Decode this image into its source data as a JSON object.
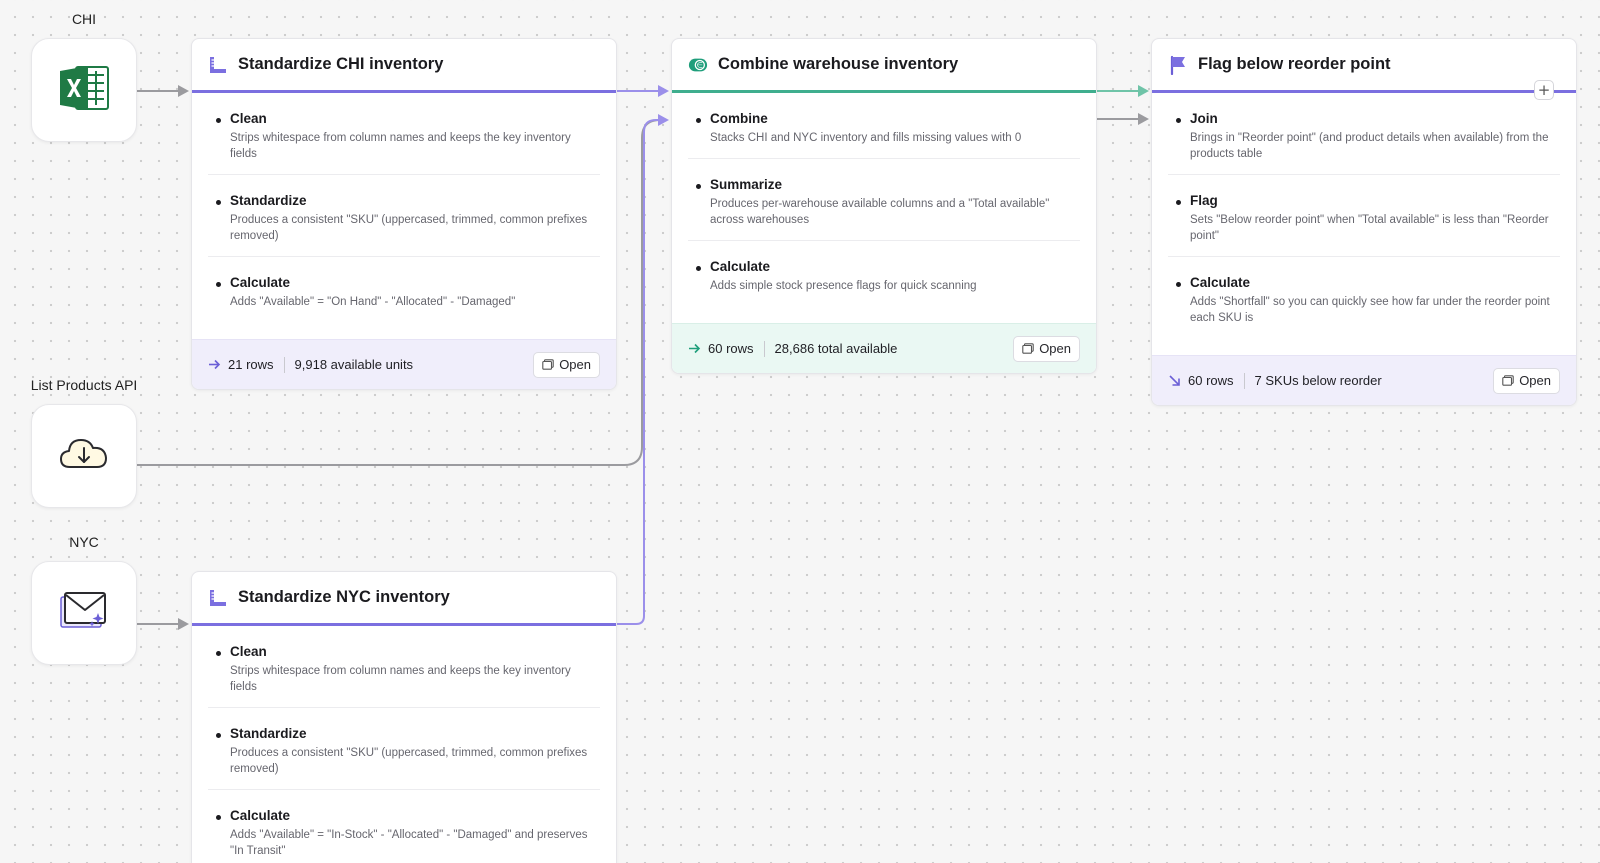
{
  "sources": {
    "chi": {
      "label": "CHI",
      "icon": "excel-icon"
    },
    "api": {
      "label": "List Products API",
      "icon": "cloud-download-icon"
    },
    "nyc": {
      "label": "NYC",
      "icon": "email-sparkle-icon"
    }
  },
  "cards": {
    "std_chi": {
      "title": "Standardize CHI inventory",
      "icon": "ruler-icon",
      "steps": [
        {
          "title": "Clean",
          "desc": "Strips whitespace from column names and keeps the key inventory fields"
        },
        {
          "title": "Standardize",
          "desc": "Produces a consistent \"SKU\" (uppercased, trimmed, common prefixes removed)"
        },
        {
          "title": "Calculate",
          "desc": "Adds \"Available\" = \"On Hand\" - \"Allocated\" - \"Damaged\""
        }
      ],
      "footer": {
        "rows": "21 rows",
        "metric": "9,918 available units",
        "open": "Open"
      }
    },
    "combine": {
      "title": "Combine warehouse inventory",
      "icon": "combine-icon",
      "steps": [
        {
          "title": "Combine",
          "desc": "Stacks CHI and NYC inventory and fills missing values with 0"
        },
        {
          "title": "Summarize",
          "desc": "Produces per-warehouse available columns and a \"Total available\" across warehouses"
        },
        {
          "title": "Calculate",
          "desc": "Adds simple stock presence flags for quick scanning"
        }
      ],
      "footer": {
        "rows": "60 rows",
        "metric": "28,686 total available",
        "open": "Open"
      }
    },
    "flag": {
      "title": "Flag below reorder point",
      "icon": "flag-icon",
      "steps": [
        {
          "title": "Join",
          "desc": "Brings in \"Reorder point\" (and product details when available) from the products table"
        },
        {
          "title": "Flag",
          "desc": "Sets \"Below reorder point\" when \"Total available\" is less than \"Reorder point\""
        },
        {
          "title": "Calculate",
          "desc": "Adds \"Shortfall\" so you can quickly see how far under the reorder point each SKU is"
        }
      ],
      "footer": {
        "rows": "60 rows",
        "metric": "7 SKUs below reorder",
        "open": "Open"
      }
    },
    "std_nyc": {
      "title": "Standardize NYC inventory",
      "icon": "ruler-icon",
      "steps": [
        {
          "title": "Clean",
          "desc": "Strips whitespace from column names and keeps the key inventory fields"
        },
        {
          "title": "Standardize",
          "desc": "Produces a consistent \"SKU\" (uppercased, trimmed, common prefixes removed)"
        },
        {
          "title": "Calculate",
          "desc": "Adds \"Available\" = \"In-Stock\" - \"Allocated\" - \"Damaged\" and preserves \"In Transit\""
        }
      ]
    }
  },
  "add_button": "+",
  "colors": {
    "purple_accent": "#7b6fe0",
    "green_accent": "#3fae8e",
    "connector_gray": "#9b9b9f",
    "excel_green": "#1f7a45"
  }
}
